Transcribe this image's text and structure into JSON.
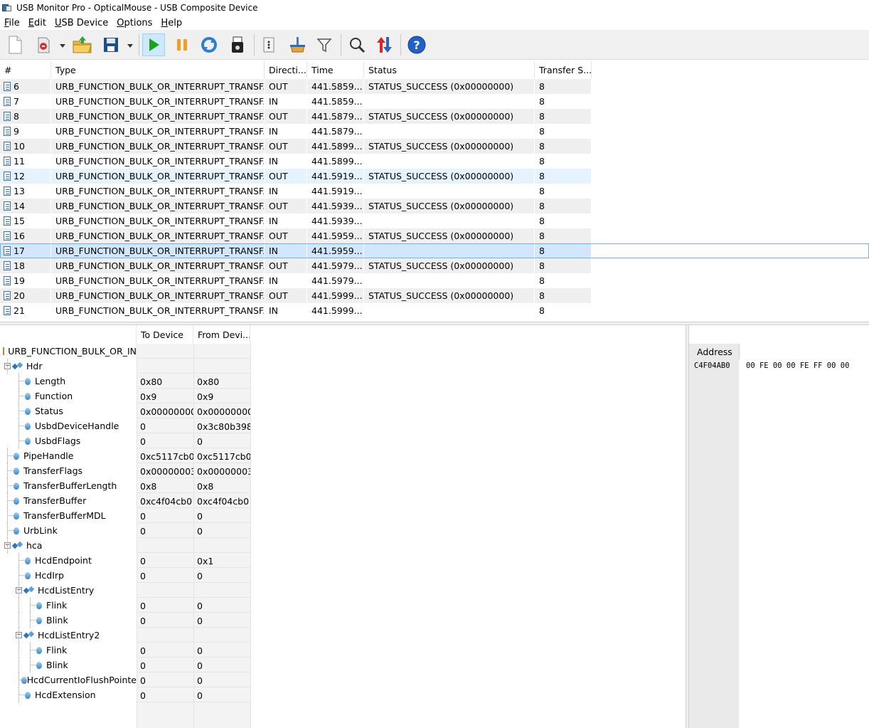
{
  "window": {
    "title": "USB Monitor Pro - OpticalMouse - USB Composite Device"
  },
  "menu": [
    {
      "label": "File",
      "mnemonic": "F"
    },
    {
      "label": "Edit",
      "mnemonic": "E"
    },
    {
      "label": "USB Device",
      "mnemonic": "U"
    },
    {
      "label": "Options",
      "mnemonic": "O"
    },
    {
      "label": "Help",
      "mnemonic": "H"
    }
  ],
  "toolbar": {
    "buttons": [
      "new-document",
      "new-session",
      "open-folder",
      "save",
      "start-capture",
      "pause-capture",
      "refresh",
      "usb-device",
      "properties",
      "clear-log",
      "filter",
      "search",
      "sort",
      "help"
    ],
    "colors": {
      "play": "#1aa31a",
      "pause": "#f0a020",
      "help": "#2060c8",
      "refresh": "#2a7fd4"
    }
  },
  "list": {
    "columns": [
      "#",
      "Type",
      "Directi...",
      "Time",
      "Status",
      "Transfer S..."
    ],
    "rows": [
      {
        "n": "6",
        "type": "URB_FUNCTION_BULK_OR_INTERRUPT_TRANSF...",
        "dir": "OUT",
        "time": "441.5859...",
        "status": "STATUS_SUCCESS (0x00000000)",
        "size": "8"
      },
      {
        "n": "7",
        "type": "URB_FUNCTION_BULK_OR_INTERRUPT_TRANSF...",
        "dir": "IN",
        "time": "441.5859...",
        "status": "",
        "size": "8"
      },
      {
        "n": "8",
        "type": "URB_FUNCTION_BULK_OR_INTERRUPT_TRANSF...",
        "dir": "OUT",
        "time": "441.5879...",
        "status": "STATUS_SUCCESS (0x00000000)",
        "size": "8"
      },
      {
        "n": "9",
        "type": "URB_FUNCTION_BULK_OR_INTERRUPT_TRANSF...",
        "dir": "IN",
        "time": "441.5879...",
        "status": "",
        "size": "8"
      },
      {
        "n": "10",
        "type": "URB_FUNCTION_BULK_OR_INTERRUPT_TRANSF...",
        "dir": "OUT",
        "time": "441.5899...",
        "status": "STATUS_SUCCESS (0x00000000)",
        "size": "8"
      },
      {
        "n": "11",
        "type": "URB_FUNCTION_BULK_OR_INTERRUPT_TRANSF...",
        "dir": "IN",
        "time": "441.5899...",
        "status": "",
        "size": "8"
      },
      {
        "n": "12",
        "type": "URB_FUNCTION_BULK_OR_INTERRUPT_TRANSF...",
        "dir": "OUT",
        "time": "441.5919...",
        "status": "STATUS_SUCCESS (0x00000000)",
        "size": "8"
      },
      {
        "n": "13",
        "type": "URB_FUNCTION_BULK_OR_INTERRUPT_TRANSF...",
        "dir": "IN",
        "time": "441.5919...",
        "status": "",
        "size": "8"
      },
      {
        "n": "14",
        "type": "URB_FUNCTION_BULK_OR_INTERRUPT_TRANSF...",
        "dir": "OUT",
        "time": "441.5939...",
        "status": "STATUS_SUCCESS (0x00000000)",
        "size": "8"
      },
      {
        "n": "15",
        "type": "URB_FUNCTION_BULK_OR_INTERRUPT_TRANSF...",
        "dir": "IN",
        "time": "441.5939...",
        "status": "",
        "size": "8"
      },
      {
        "n": "16",
        "type": "URB_FUNCTION_BULK_OR_INTERRUPT_TRANSF...",
        "dir": "OUT",
        "time": "441.5959...",
        "status": "STATUS_SUCCESS (0x00000000)",
        "size": "8"
      },
      {
        "n": "17",
        "type": "URB_FUNCTION_BULK_OR_INTERRUPT_TRANSF...",
        "dir": "IN",
        "time": "441.5959...",
        "status": "",
        "size": "8"
      },
      {
        "n": "18",
        "type": "URB_FUNCTION_BULK_OR_INTERRUPT_TRANSF...",
        "dir": "OUT",
        "time": "441.5979...",
        "status": "STATUS_SUCCESS (0x00000000)",
        "size": "8"
      },
      {
        "n": "19",
        "type": "URB_FUNCTION_BULK_OR_INTERRUPT_TRANSF...",
        "dir": "IN",
        "time": "441.5979...",
        "status": "",
        "size": "8"
      },
      {
        "n": "20",
        "type": "URB_FUNCTION_BULK_OR_INTERRUPT_TRANSF...",
        "dir": "OUT",
        "time": "441.5999...",
        "status": "STATUS_SUCCESS (0x00000000)",
        "size": "8"
      },
      {
        "n": "21",
        "type": "URB_FUNCTION_BULK_OR_INTERRUPT_TRANSF...",
        "dir": "IN",
        "time": "441.5999...",
        "status": "",
        "size": "8"
      }
    ],
    "selected_row": "17",
    "hover_row": "12"
  },
  "tree": {
    "columns": [
      "",
      "To Device",
      "From Devi..."
    ],
    "nodes": [
      {
        "label": "URB_FUNCTION_BULK_OR_IN",
        "level": 0,
        "kind": "folder",
        "to": "",
        "from": ""
      },
      {
        "label": "Hdr",
        "level": 0,
        "kind": "struct",
        "expanded": true,
        "to": "",
        "from": ""
      },
      {
        "label": "Length",
        "level": 1,
        "kind": "field",
        "to": "0x80",
        "from": "0x80"
      },
      {
        "label": "Function",
        "level": 1,
        "kind": "field",
        "to": "0x9",
        "from": "0x9"
      },
      {
        "label": "Status",
        "level": 1,
        "kind": "field",
        "to": "0x00000000 (",
        "from": "0x00000000 ("
      },
      {
        "label": "UsbdDeviceHandle",
        "level": 1,
        "kind": "field",
        "to": "0",
        "from": "0x3c80b398"
      },
      {
        "label": "UsbdFlags",
        "level": 1,
        "kind": "field",
        "to": "0",
        "from": "0"
      },
      {
        "label": "PipeHandle",
        "level": 0,
        "kind": "field",
        "to": "0xc5117cb0",
        "from": "0xc5117cb0"
      },
      {
        "label": "TransferFlags",
        "level": 0,
        "kind": "field",
        "to": "0x00000003 (",
        "from": "0x00000003 ("
      },
      {
        "label": "TransferBufferLength",
        "level": 0,
        "kind": "field",
        "to": "0x8",
        "from": "0x8"
      },
      {
        "label": "TransferBuffer",
        "level": 0,
        "kind": "field",
        "to": "0xc4f04cb0",
        "from": "0xc4f04cb0"
      },
      {
        "label": "TransferBufferMDL",
        "level": 0,
        "kind": "field",
        "to": "0",
        "from": "0"
      },
      {
        "label": "UrbLink",
        "level": 0,
        "kind": "field",
        "to": "0",
        "from": "0"
      },
      {
        "label": "hca",
        "level": 0,
        "kind": "struct",
        "expanded": true,
        "to": "",
        "from": ""
      },
      {
        "label": "HcdEndpoint",
        "level": 1,
        "kind": "field",
        "to": "0",
        "from": "0x1"
      },
      {
        "label": "HcdIrp",
        "level": 1,
        "kind": "field",
        "to": "0",
        "from": "0"
      },
      {
        "label": "HcdListEntry",
        "level": 1,
        "kind": "struct",
        "expanded": true,
        "to": "",
        "from": ""
      },
      {
        "label": "Flink",
        "level": 2,
        "kind": "field",
        "to": "0",
        "from": "0"
      },
      {
        "label": "Blink",
        "level": 2,
        "kind": "field",
        "to": "0",
        "from": "0"
      },
      {
        "label": "HcdListEntry2",
        "level": 1,
        "kind": "struct",
        "expanded": true,
        "to": "",
        "from": ""
      },
      {
        "label": "Flink",
        "level": 2,
        "kind": "field",
        "to": "0",
        "from": "0"
      },
      {
        "label": "Blink",
        "level": 2,
        "kind": "field",
        "to": "0",
        "from": "0"
      },
      {
        "label": "HcdCurrentIoFlushPointe",
        "level": 1,
        "kind": "field",
        "to": "0",
        "from": "0"
      },
      {
        "label": "HcdExtension",
        "level": 1,
        "kind": "field",
        "to": "0",
        "from": "0"
      }
    ]
  },
  "hex": {
    "header": "Address",
    "rows": [
      {
        "address": "C4F04AB0",
        "bytes": "00 FE 00 00 FE FF 00 00"
      }
    ]
  }
}
